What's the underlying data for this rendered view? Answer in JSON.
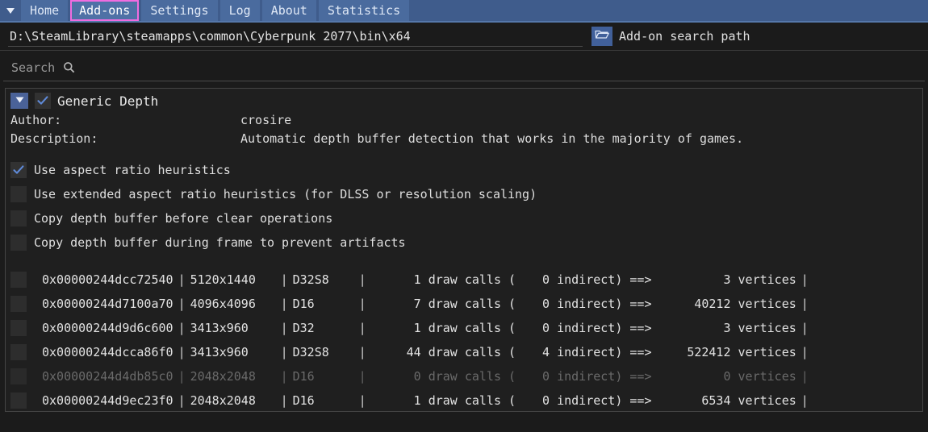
{
  "tabbar": {
    "collapse_icon": "chevron-down-icon",
    "tabs": [
      {
        "label": "Home",
        "active": false
      },
      {
        "label": "Add-ons",
        "active": true
      },
      {
        "label": "Settings",
        "active": false
      },
      {
        "label": "Log",
        "active": false
      },
      {
        "label": "About",
        "active": false
      },
      {
        "label": "Statistics",
        "active": false
      }
    ],
    "active_border_color": "#f06ce0",
    "bar_color": "#3f5c8c"
  },
  "path_row": {
    "value": "D:\\SteamLibrary\\steamapps\\common\\Cyberpunk 2077\\bin\\x64",
    "placeholder": "Add-on search path",
    "folder_icon": "folder-open-icon",
    "label": "Add-on search path"
  },
  "search": {
    "value": "",
    "placeholder": "Search",
    "label": "Search",
    "icon": "magnifier-icon"
  },
  "addon": {
    "expanded": true,
    "enabled": true,
    "title": "Generic Depth",
    "meta": [
      {
        "key": "Author:",
        "value": "crosire"
      },
      {
        "key": "Description:",
        "value": "Automatic depth buffer detection that works in the majority of games."
      }
    ],
    "options": [
      {
        "label": "Use aspect ratio heuristics",
        "checked": true
      },
      {
        "label": "Use extended aspect ratio heuristics (for DLSS or resolution scaling)",
        "checked": false
      },
      {
        "label": "Copy depth buffer before clear operations",
        "checked": false
      },
      {
        "label": "Copy depth buffer during frame to prevent artifacts",
        "checked": false
      }
    ]
  },
  "buffers": {
    "rows": [
      {
        "checked": false,
        "dim": false,
        "address": "0x00000244dcc72540",
        "resolution": "5120x1440",
        "format": "D32S8",
        "draw_calls": "1",
        "draw_calls_label": "draw calls (",
        "indirect": "0",
        "indirect_label": "indirect)",
        "arrow": "==>",
        "vertices": "3",
        "vertices_label": "vertices"
      },
      {
        "checked": false,
        "dim": false,
        "address": "0x00000244d7100a70",
        "resolution": "4096x4096",
        "format": "D16",
        "draw_calls": "7",
        "draw_calls_label": "draw calls (",
        "indirect": "0",
        "indirect_label": "indirect)",
        "arrow": "==>",
        "vertices": "40212",
        "vertices_label": "vertices"
      },
      {
        "checked": false,
        "dim": false,
        "address": "0x00000244d9d6c600",
        "resolution": "3413x960",
        "format": "D32",
        "draw_calls": "1",
        "draw_calls_label": "draw calls (",
        "indirect": "0",
        "indirect_label": "indirect)",
        "arrow": "==>",
        "vertices": "3",
        "vertices_label": "vertices"
      },
      {
        "checked": false,
        "dim": false,
        "address": "0x00000244dcca86f0",
        "resolution": "3413x960",
        "format": "D32S8",
        "draw_calls": "44",
        "draw_calls_label": "draw calls (",
        "indirect": "4",
        "indirect_label": "indirect)",
        "arrow": "==>",
        "vertices": "522412",
        "vertices_label": "vertices"
      },
      {
        "checked": false,
        "dim": true,
        "address": "0x00000244d4db85c0",
        "resolution": "2048x2048",
        "format": "D16",
        "draw_calls": "0",
        "draw_calls_label": "draw calls (",
        "indirect": "0",
        "indirect_label": "indirect)",
        "arrow": "==>",
        "vertices": "0",
        "vertices_label": "vertices"
      },
      {
        "checked": false,
        "dim": false,
        "address": "0x00000244d9ec23f0",
        "resolution": "2048x2048",
        "format": "D16",
        "draw_calls": "1",
        "draw_calls_label": "draw calls (",
        "indirect": "0",
        "indirect_label": "indirect)",
        "arrow": "==>",
        "vertices": "6534",
        "vertices_label": "vertices"
      }
    ]
  },
  "colors": {
    "background": "#1b1b1b",
    "panel": "#1f1f1f",
    "accent_blue": "#4a6b9e",
    "active_tab_outline": "#f06ce0",
    "checkmark": "#5f8ad8"
  }
}
